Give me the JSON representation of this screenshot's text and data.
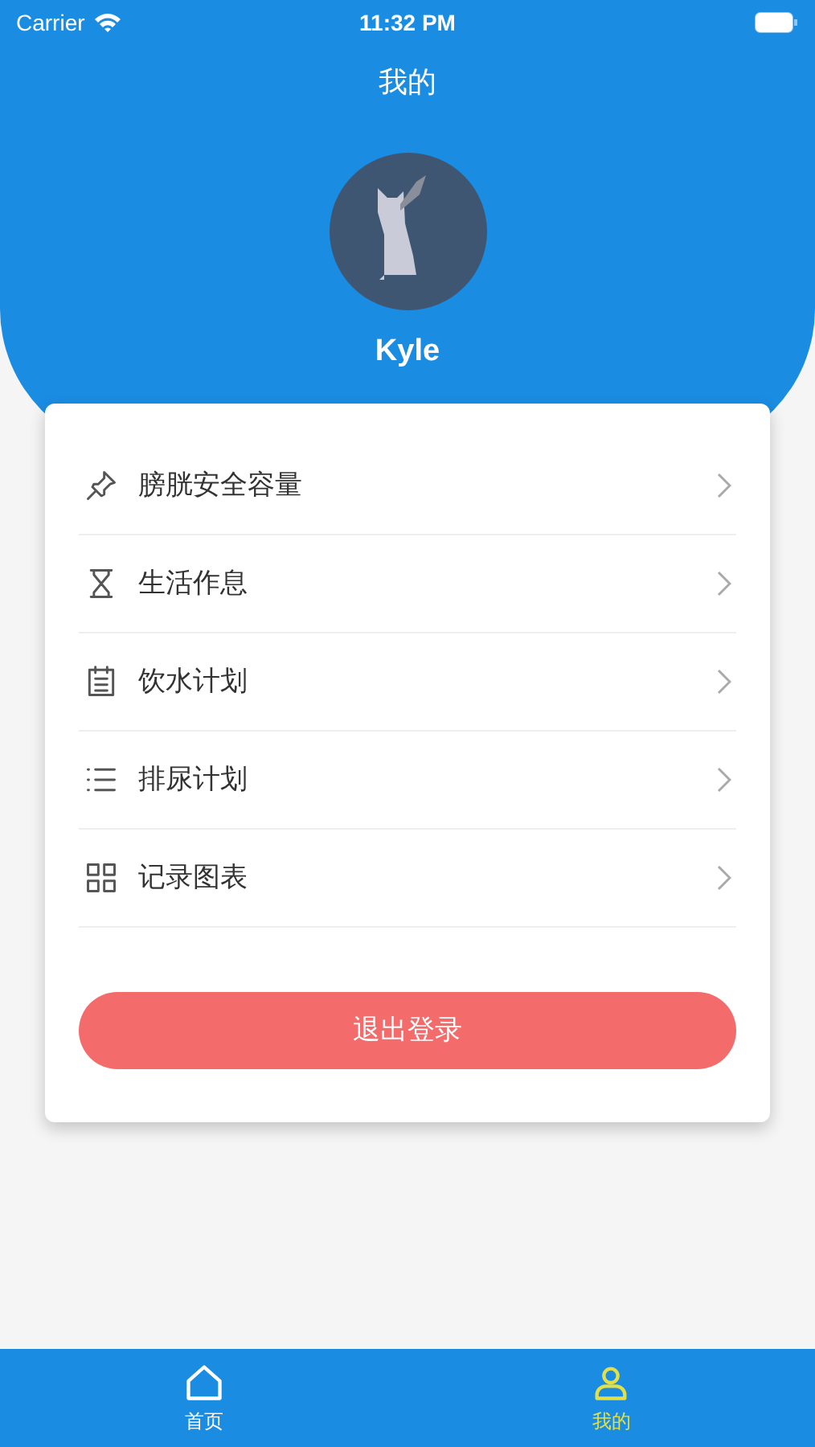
{
  "status_bar": {
    "carrier": "Carrier",
    "time": "11:32 PM"
  },
  "header": {
    "title": "我的",
    "username": "Kyle"
  },
  "menu": [
    {
      "kind": "pin",
      "label": "膀胱安全容量"
    },
    {
      "kind": "hourglass",
      "label": "生活作息"
    },
    {
      "kind": "notepad",
      "label": "饮水计划"
    },
    {
      "kind": "list",
      "label": "排尿计划"
    },
    {
      "kind": "grid",
      "label": "记录图表"
    }
  ],
  "logout_button": "退出登录",
  "tab_bar": [
    {
      "kind": "home",
      "label": "首页",
      "selected": false
    },
    {
      "kind": "person",
      "label": "我的",
      "selected": true
    }
  ]
}
